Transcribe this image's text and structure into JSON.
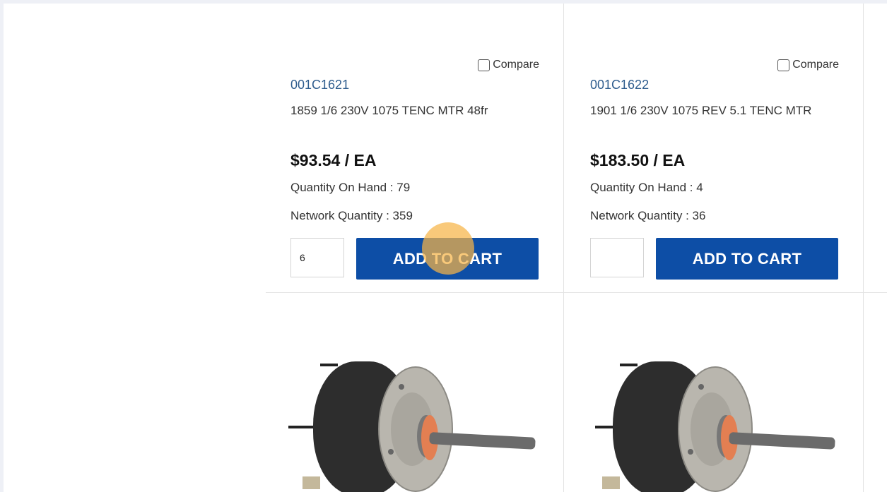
{
  "products": [
    {
      "compare_label": "Compare",
      "part_number": "001C1621",
      "description": "1859 1/6 230V 1075 TENC MTR 48fr",
      "price": "$93.54 / EA",
      "quantity_on_hand": "Quantity On Hand : 79",
      "network_quantity": "Network Quantity : 359",
      "qty_value": "6",
      "add_to_cart_label": "ADD TO CART"
    },
    {
      "compare_label": "Compare",
      "part_number": "001C1622",
      "description": "1901 1/6 230V 1075 REV 5.1 TENC MTR",
      "price": "$183.50 / EA",
      "quantity_on_hand": "Quantity On Hand : 4",
      "network_quantity": "Network Quantity : 36",
      "qty_value": "",
      "add_to_cart_label": "ADD TO CART"
    }
  ],
  "colors": {
    "button_bg": "#0d4ea6",
    "part_number_link": "#2f5d8e",
    "click_highlight": "#f6b446"
  },
  "icons": {
    "compare": "checkbox-icon",
    "product_image": "fan-motor-image"
  }
}
